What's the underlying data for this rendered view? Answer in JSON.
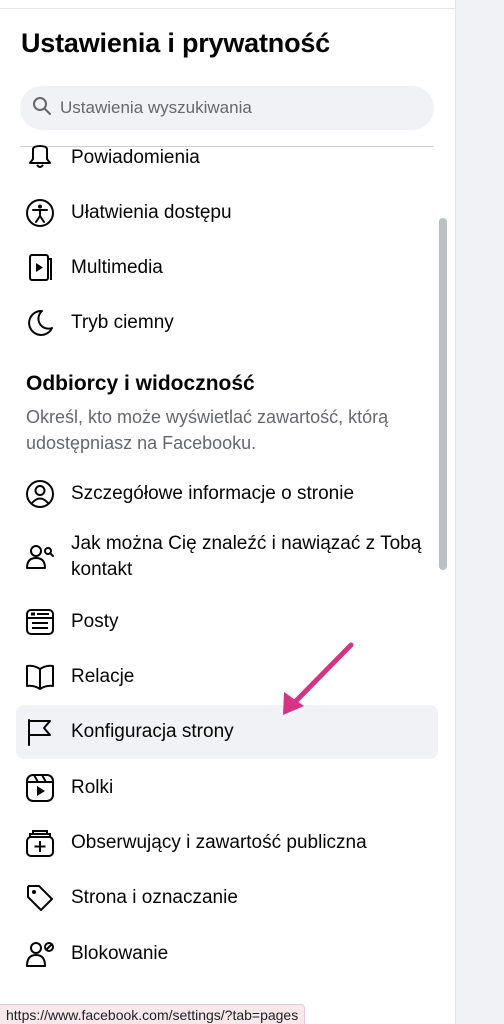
{
  "header": {
    "title": "Ustawienia i prywatność"
  },
  "search": {
    "placeholder": "Ustawienia wyszukiwania",
    "icon": "search-icon"
  },
  "menu_top": [
    {
      "label": "Powiadomienia",
      "icon": "bell-icon"
    },
    {
      "label": "Ułatwienia dostępu",
      "icon": "accessibility-icon"
    },
    {
      "label": "Multimedia",
      "icon": "media-icon"
    },
    {
      "label": "Tryb ciemny",
      "icon": "moon-icon"
    }
  ],
  "section": {
    "title": "Odbiorcy i widoczność",
    "description": "Określ, kto może wyświetlać zawartość, którą udostępniasz na Facebooku."
  },
  "menu_section": [
    {
      "label": "Szczegółowe informacje o stronie",
      "icon": "profile-circle-icon"
    },
    {
      "label": "Jak można Cię znaleźć i nawiązać z Tobą kontakt",
      "icon": "person-search-icon"
    },
    {
      "label": "Posty",
      "icon": "post-icon"
    },
    {
      "label": "Relacje",
      "icon": "book-icon"
    },
    {
      "label": "Konfiguracja strony",
      "icon": "flag-icon",
      "active": true
    },
    {
      "label": "Rolki",
      "icon": "reels-icon"
    },
    {
      "label": "Obserwujący i zawartość publiczna",
      "icon": "followers-add-icon"
    },
    {
      "label": "Strona i oznaczanie",
      "icon": "tag-icon"
    },
    {
      "label": "Blokowanie",
      "icon": "block-user-icon"
    }
  ],
  "status_bar": {
    "url": "https://www.facebook.com/settings/?tab=pages"
  },
  "colors": {
    "annotation_arrow": "#d63384",
    "active_bg": "#f0f2f5",
    "secondary_text": "#65676b"
  }
}
